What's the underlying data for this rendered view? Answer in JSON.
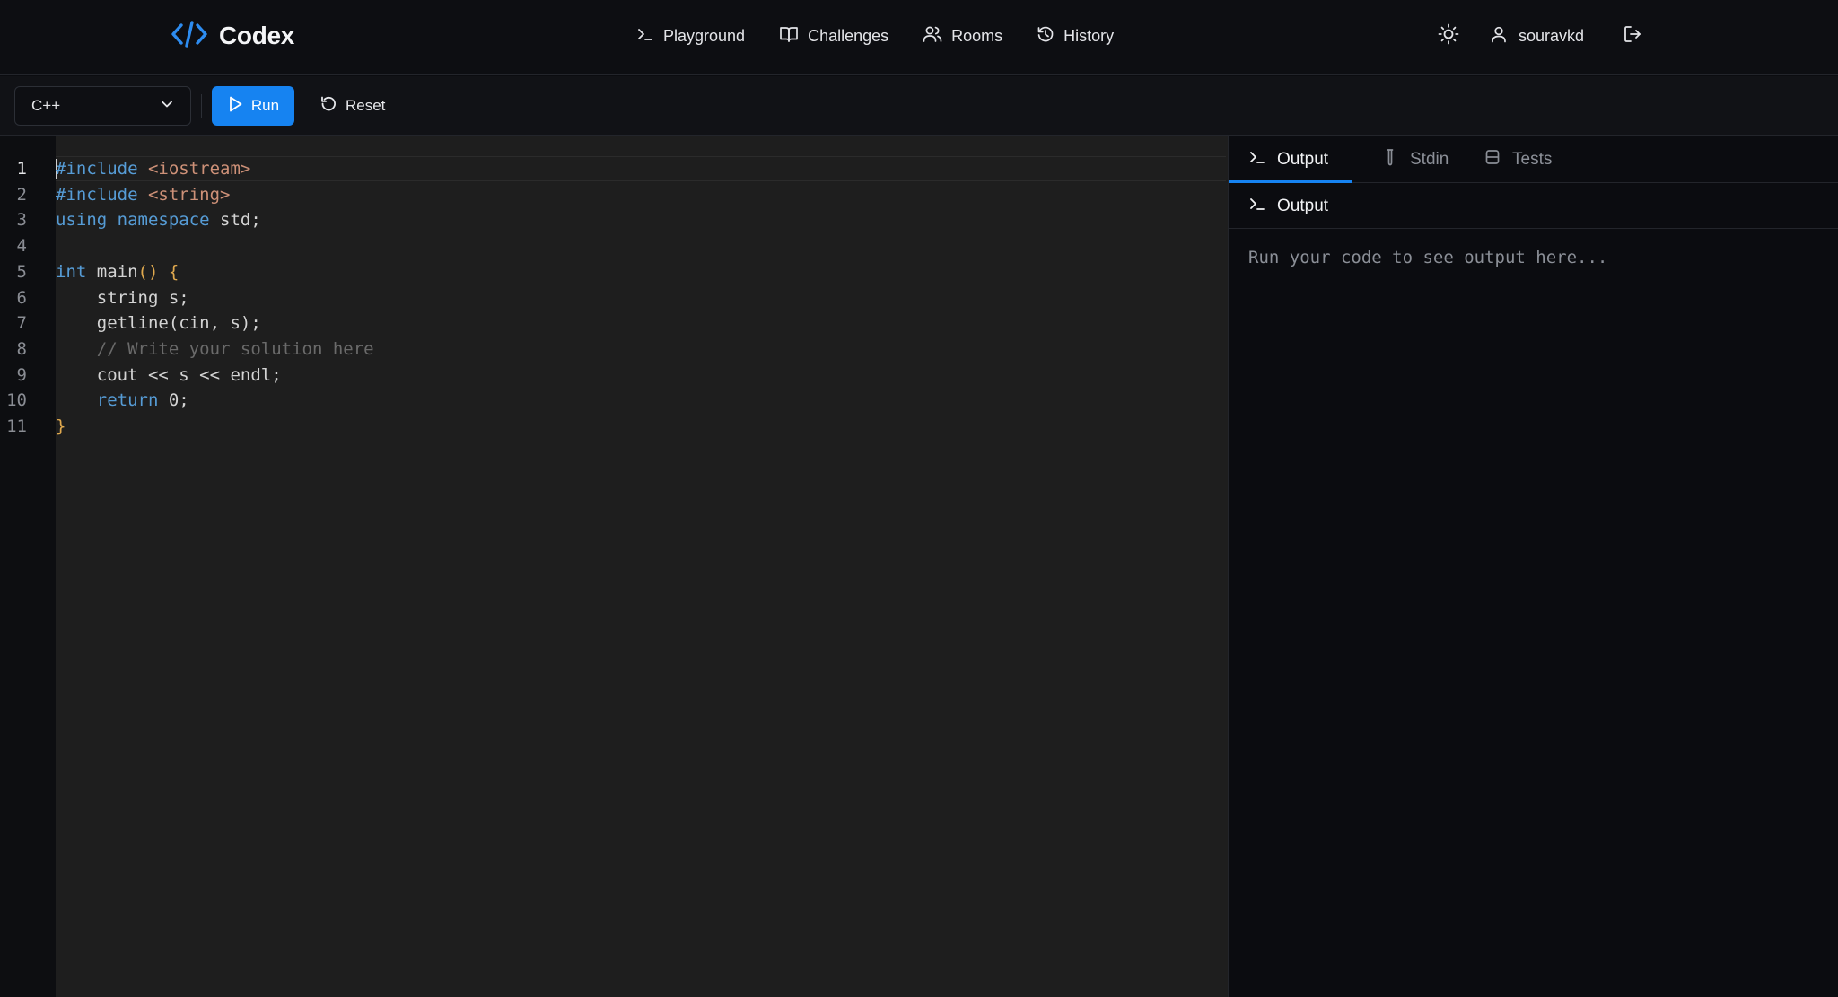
{
  "header": {
    "brand": {
      "icon": "code-brackets-icon",
      "name": "Codex"
    },
    "nav": [
      {
        "icon": "terminal-icon",
        "label": "Playground"
      },
      {
        "icon": "book-icon",
        "label": "Challenges"
      },
      {
        "icon": "users-icon",
        "label": "Rooms"
      },
      {
        "icon": "history-icon",
        "label": "History"
      }
    ],
    "theme_toggle_icon": "sun-icon",
    "user": {
      "icon": "user-icon",
      "name": "souravkd"
    },
    "logout_icon": "logout-icon"
  },
  "toolbar": {
    "language": {
      "selected": "C++",
      "icon": "chevron-down-icon"
    },
    "run_label": "Run",
    "reset_label": "Reset"
  },
  "editor": {
    "active_line": 1,
    "line_numbers": [
      "1",
      "2",
      "3",
      "4",
      "5",
      "6",
      "7",
      "8",
      "9",
      "10",
      "11"
    ],
    "lines": [
      [
        {
          "t": "#include ",
          "c": "kw"
        },
        {
          "t": "<iostream>",
          "c": "str"
        }
      ],
      [
        {
          "t": "#include ",
          "c": "kw"
        },
        {
          "t": "<string>",
          "c": "str"
        }
      ],
      [
        {
          "t": "using namespace",
          "c": "kw"
        },
        {
          "t": " std;",
          "c": ""
        }
      ],
      [],
      [
        {
          "t": "int",
          "c": "kw"
        },
        {
          "t": " main",
          "c": ""
        },
        {
          "t": "() {",
          "c": "brace"
        }
      ],
      [
        {
          "t": "    string s;",
          "c": ""
        }
      ],
      [
        {
          "t": "    getline(cin, s);",
          "c": ""
        }
      ],
      [
        {
          "t": "    // Write your solution here",
          "c": "comment"
        }
      ],
      [
        {
          "t": "    cout << s << endl;",
          "c": ""
        }
      ],
      [
        {
          "t": "    ",
          "c": ""
        },
        {
          "t": "return",
          "c": "kw"
        },
        {
          "t": " 0;",
          "c": ""
        }
      ],
      [
        {
          "t": "}",
          "c": "brace"
        }
      ]
    ]
  },
  "panel": {
    "tabs": [
      {
        "icon": "terminal-icon",
        "label": "Output",
        "active": true
      },
      {
        "icon": "test-tube-icon",
        "label": "Stdin",
        "active": false
      },
      {
        "icon": "tests-icon",
        "label": "Tests",
        "active": false
      }
    ],
    "output_title": "Output",
    "output_placeholder": "Run your code to see output here..."
  },
  "colors": {
    "accent": "#1683f1",
    "keyword": "#569cd6",
    "string": "#ce9178",
    "brace": "#e0a94e",
    "comment": "#6a6a6a"
  }
}
